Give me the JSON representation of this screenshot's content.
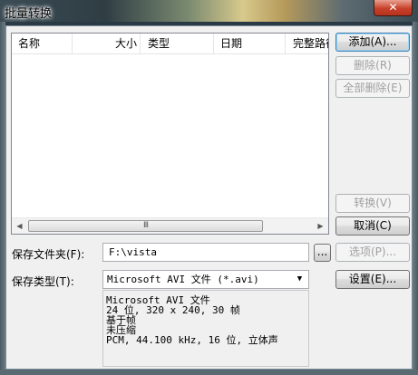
{
  "window": {
    "title": "批量转换",
    "close_glyph": "✕"
  },
  "list": {
    "columns": [
      "名称",
      "大小",
      "类型",
      "日期",
      "完整路径"
    ],
    "scroll_thumb_grip": "III"
  },
  "buttons": {
    "add": "添加(A)...",
    "delete": "删除(R)",
    "delete_all": "全部删除(E)",
    "convert": "转换(V)",
    "cancel": "取消(C)",
    "browse": "...",
    "options": "选项(P)...",
    "settings": "设置(E)..."
  },
  "save_folder": {
    "label": "保存文件夹(F):",
    "value": "F:\\vista"
  },
  "save_type": {
    "label": "保存类型(T):",
    "selected": "Microsoft AVI 文件 (*.avi)"
  },
  "format_info": [
    "Microsoft AVI 文件",
    "24 位, 320 x 240, 30 帧",
    "基于帧",
    "未压缩",
    "PCM, 44.100 kHz, 16 位, 立体声"
  ],
  "icons": {
    "close": "close-icon",
    "dropdown": "chevron-down-icon",
    "scroll_left": "arrow-left-icon",
    "scroll_right": "arrow-right-icon"
  }
}
